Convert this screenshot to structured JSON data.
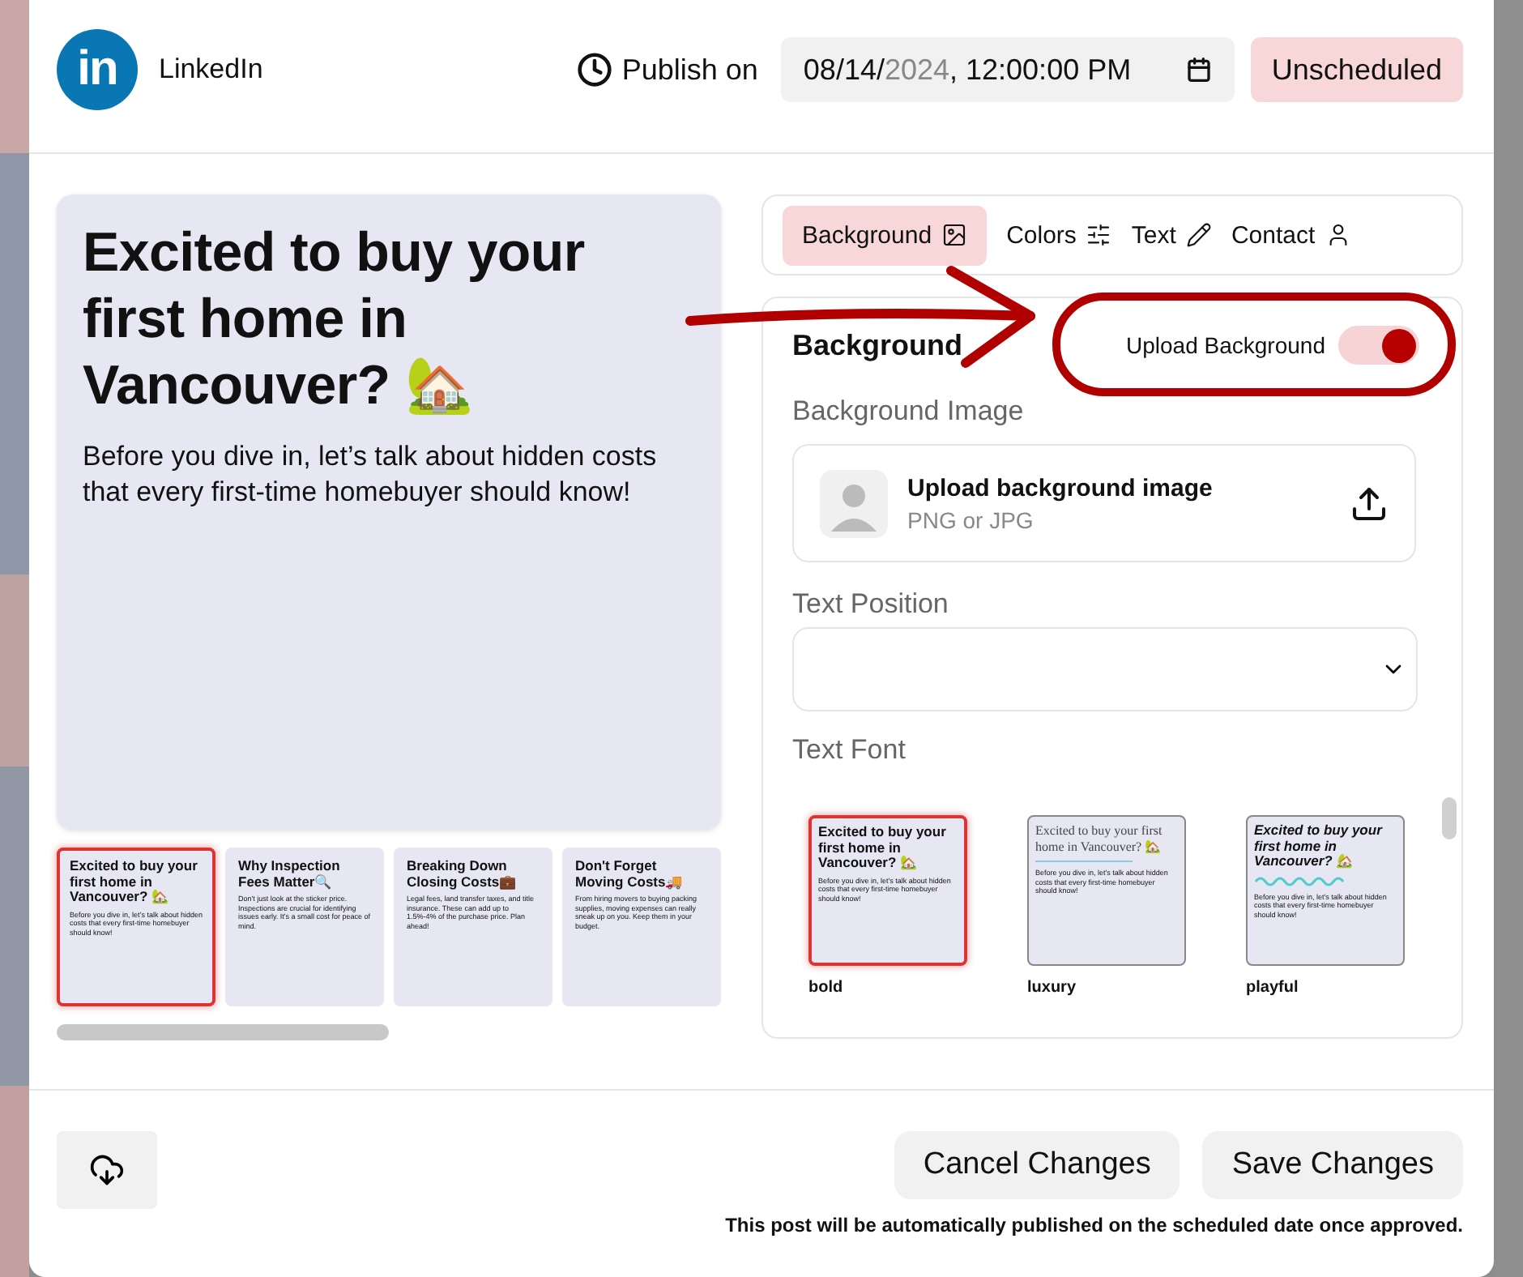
{
  "header": {
    "logo": {
      "text": "in"
    },
    "platform": "LinkedIn",
    "publish_label": "Publish on",
    "date_parts": [
      {
        "text": "08/14/",
        "dim": false
      },
      {
        "text": "2024",
        "dim": true
      },
      {
        "text": ", 12:00:00 PM",
        "dim": false
      }
    ],
    "status": "Unscheduled"
  },
  "preview": {
    "title": "Excited to buy your first home in Vancouver? 🏡",
    "body": "Before you dive in, let’s talk about hidden costs that every first-time homebuyer should know!"
  },
  "slides": [
    {
      "title": "Excited to buy your first home in Vancouver? 🏡",
      "body": "Before you dive in, let’s talk about hidden costs that every first-time homebuyer should know!",
      "selected": true
    },
    {
      "title": "Why Inspection Fees Matter🔍",
      "body": "Don't just look at the sticker price. Inspections are crucial for identifying issues early. It's a small cost for peace of mind.",
      "selected": false
    },
    {
      "title": "Breaking Down Closing Costs💼",
      "body": "Legal fees, land transfer taxes, and title insurance. These can add up to 1.5%-4% of the purchase price. Plan ahead!",
      "selected": false
    },
    {
      "title": "Don't Forget Moving Costs🚚",
      "body": "From hiring movers to buying packing supplies, moving expenses can really sneak up on you. Keep them in your budget.",
      "selected": false
    }
  ],
  "tabs": [
    {
      "label": "Background",
      "selected": true
    },
    {
      "label": "Colors",
      "selected": false
    },
    {
      "label": "Text",
      "selected": false
    },
    {
      "label": "Contact",
      "selected": false
    }
  ],
  "settings": {
    "section_title": "Background",
    "toggle": {
      "label": "Upload Background",
      "on": true
    },
    "background_image": {
      "label": "Background Image",
      "upload_title": "Upload background image",
      "upload_hint": "PNG or JPG"
    },
    "text_position": {
      "label": "Text Position"
    },
    "text_font": {
      "label": "Text Font",
      "options": [
        {
          "name": "bold",
          "kind": "bold",
          "selected": true,
          "title": "Excited to buy your first home in Vancouver? 🏡",
          "body": "Before you dive in, let's talk about hidden costs that every first-time homebuyer should know!"
        },
        {
          "name": "luxury",
          "kind": "luxury",
          "selected": false,
          "title": "Excited to buy your first home in Vancouver? 🏡",
          "body": "Before you dive in, let's talk about hidden costs that every first-time homebuyer should know!"
        },
        {
          "name": "playful",
          "kind": "playful",
          "selected": false,
          "title": "Excited to buy your first home in Vancouver? 🏡",
          "body": "Before you dive in, let's talk about hidden costs that every first-time homebuyer should know!"
        }
      ]
    }
  },
  "footer": {
    "cancel": "Cancel Changes",
    "save": "Save Changes",
    "note": "This post will be automatically published on the scheduled date once approved."
  }
}
